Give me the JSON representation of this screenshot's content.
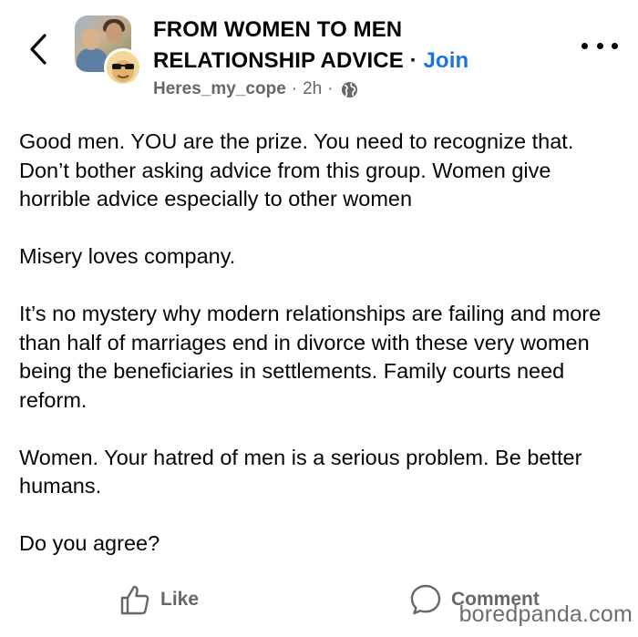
{
  "header": {
    "group_name": "FROM WOMEN TO MEN RELATIONSHIP ADVICE",
    "separator": "·",
    "join_label": "Join",
    "author": "Heres_my_cope",
    "time": "2h",
    "meta_separator": "·",
    "privacy_icon": "globe-icon",
    "back_icon": "chevron-left-icon",
    "more_icon": "more-horizontal-icon"
  },
  "post": {
    "paragraphs": [
      "Good men.  YOU are the prize.  You need to recognize that.   Don’t bother asking advice from this group. Women give horrible advice especially to other women",
      "Misery loves company.",
      "It’s no mystery why modern relationships are failing and more than half of marriages end in divorce with these very women being the beneficiaries in settlements.  Family courts need reform.",
      "Women.  Your hatred of men is a serious problem.  Be better humans.",
      "Do you agree?"
    ]
  },
  "actions": {
    "like_label": "Like",
    "comment_label": "Comment",
    "like_icon": "thumbs-up-icon",
    "comment_icon": "comment-bubble-icon"
  },
  "watermark": "boredpanda.com",
  "colors": {
    "join": "#1b74e4",
    "secondary_text": "#65676b",
    "primary_text": "#050505"
  }
}
